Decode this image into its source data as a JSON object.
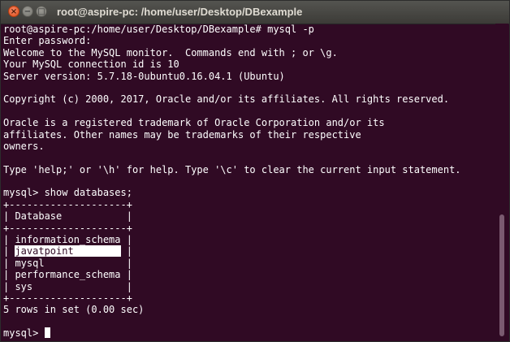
{
  "window": {
    "title": "root@aspire-pc: /home/user/Desktop/DBexample",
    "close_glyph": "×",
    "minimize_glyph": "−",
    "maximize_glyph": "□"
  },
  "terminal": {
    "colors": {
      "background": "#300a24",
      "foreground": "#ffffff",
      "titlebar": "#3c3b37",
      "close_button": "#df4a16"
    },
    "lines": {
      "command": "root@aspire-pc:/home/user/Desktop/DBexample# mysql -p",
      "password": "Enter password:",
      "welcome": "Welcome to the MySQL monitor.  Commands end with ; or \\g.",
      "connection": "Your MySQL connection id is 10",
      "version": "Server version: 5.7.18-0ubuntu0.16.04.1 (Ubuntu)",
      "copyright": "Copyright (c) 2000, 2017, Oracle and/or its affiliates. All rights reserved.",
      "trademark_1": "Oracle is a registered trademark of Oracle Corporation and/or its",
      "trademark_2": "affiliates. Other names may be trademarks of their respective",
      "trademark_3": "owners.",
      "help": "Type 'help;' or '\\h' for help. Type '\\c' to clear the current input statement.",
      "query": "mysql> show databases;",
      "table_border": "+--------------------+",
      "table_header": "| Database           |",
      "row_count": "5 rows in set (0.00 sec)",
      "prompt": "mysql> "
    },
    "databases": {
      "row_prefix": "| ",
      "row_suffix": " |",
      "rows": [
        {
          "pre": "| ",
          "name": "information_schema",
          "post": " |"
        },
        {
          "pre": "| ",
          "name": "javatpoint        ",
          "post": " |",
          "highlighted": true
        },
        {
          "pre": "| ",
          "name": "mysql             ",
          "post": " |"
        },
        {
          "pre": "| ",
          "name": "performance_schema",
          "post": " |"
        },
        {
          "pre": "| ",
          "name": "sys               ",
          "post": " |"
        }
      ]
    }
  }
}
